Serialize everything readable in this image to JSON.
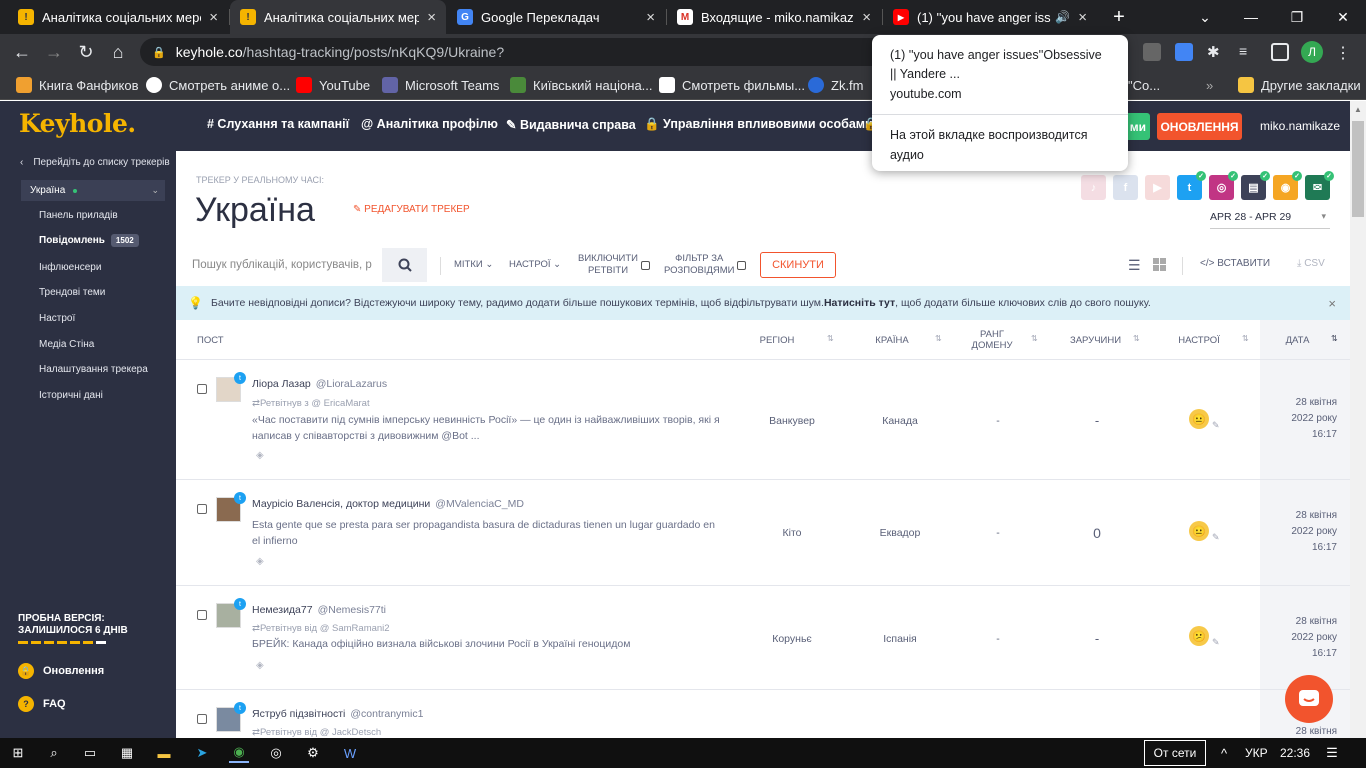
{
  "browser": {
    "tabs": [
      {
        "title": "Аналітика соціальних мереж",
        "active": false
      },
      {
        "title": "Аналітика соціальних мереж",
        "active": true
      },
      {
        "title": "Google Перекладач",
        "active": false
      },
      {
        "title": "Входящие - miko.namikaze.l",
        "active": false
      },
      {
        "title": "(1) ''you have anger iss",
        "active": false
      }
    ],
    "url_host": "keyhole.co",
    "url_path": "/hashtag-tracking/posts/nKqKQ9/Ukraine?",
    "bookmarks": [
      {
        "label": "Книга Фанфиков",
        "color": "#f0a030"
      },
      {
        "label": "Смотреть аниме о...",
        "color": "#ffffff"
      },
      {
        "label": "YouTube",
        "color": "#ff0000"
      },
      {
        "label": "Microsoft Teams",
        "color": "#6264a7"
      },
      {
        "label": "Київський націона...",
        "color": "#4a8a3a"
      },
      {
        "label": "Смотреть фильмы...",
        "color": "#ffffff"
      },
      {
        "label": "Zk.fm",
        "color": "#2a6ad8"
      },
      {
        "label": "\"Co...",
        "color": "#35363a"
      }
    ],
    "other_bookmarks": "Другие закладки",
    "profile_initial": "Л"
  },
  "tab_popup": {
    "title": "(1) ''you have anger issues''Obsessive || Yandere ...",
    "url": "youtube.com",
    "note": "На этой вкладке воспроизводится аудио"
  },
  "header": {
    "logo": "Keyhole.",
    "nav": [
      "# Слухання та кампанії",
      "@ Аналітика профілю",
      "✎ Видавнича справа",
      "🔒 Управління впливовими особами"
    ],
    "green_button": "ми",
    "upgrade_button": "ОНОВЛЕННЯ",
    "username": "miko.namikaze"
  },
  "sidebar": {
    "back": "Перейдіть до списку трекерів",
    "tracker_select": "Україна",
    "items": [
      {
        "label": "Панель приладів"
      },
      {
        "label": "Повідомлень",
        "badge": "1502",
        "active": true
      },
      {
        "label": "Інфлюенсери"
      },
      {
        "label": "Трендові теми"
      },
      {
        "label": "Настрої"
      },
      {
        "label": "Медіа Стіна"
      },
      {
        "label": "Налаштування трекера"
      },
      {
        "label": "Історичні дані"
      }
    ],
    "trial_line1": "ПРОБНА ВЕРСІЯ:",
    "trial_line2": "ЗАЛИШИЛОСЯ 6 ДНІВ",
    "trial_days_left_fraction": 0.86,
    "upgrade_link": "Оновлення",
    "faq_link": "FAQ"
  },
  "tracker": {
    "label": "ТРЕКЕР У РЕАЛЬНОМУ ЧАСІ:",
    "title": "Україна",
    "edit": "✎ РЕДАГУВАТИ ТРЕКЕР",
    "date_range": "APR 28 - APR 29",
    "networks": [
      {
        "name": "tiktok",
        "glyph": "♪",
        "color": "#e0a0b0",
        "on": false
      },
      {
        "name": "facebook",
        "glyph": "f",
        "color": "#9aaed0",
        "on": false
      },
      {
        "name": "youtube",
        "glyph": "▶",
        "color": "#e89a9a",
        "on": false
      },
      {
        "name": "twitter",
        "glyph": "t",
        "color": "#1da1f2",
        "on": true
      },
      {
        "name": "instagram",
        "glyph": "◎",
        "color": "#c13584",
        "on": true
      },
      {
        "name": "news",
        "glyph": "▤",
        "color": "#3d4258",
        "on": true
      },
      {
        "name": "rss",
        "glyph": "◉",
        "color": "#f5a623",
        "on": true
      },
      {
        "name": "forums",
        "glyph": "✉",
        "color": "#1f7a55",
        "on": true
      }
    ]
  },
  "filters": {
    "search_placeholder": "Пошук публікацій, користувачів, р",
    "tags": "МІТКИ",
    "moods": "НАСТРОЇ",
    "exclude_retweets_1": "ВИКЛЮЧИТИ",
    "exclude_retweets_2": "РЕТВІТИ",
    "filter_replies_1": "ФІЛЬТР ЗА",
    "filter_replies_2": "РОЗПОВІДЯМИ",
    "reset": "СКИНУТИ",
    "insert": "ВСТАВИТИ",
    "csv": "CSV"
  },
  "notice": {
    "text": "Бачите невідповідні дописи? Відстежуючи широку тему, радимо додати більше пошукових термінів, щоб відфільтрувати шум. ",
    "link": "Натисніть тут",
    "text_after": " , щоб додати більше ключових слів до свого пошуку."
  },
  "table": {
    "columns": {
      "post": "ПОСТ",
      "region": "РЕГІОН",
      "country": "КРАЇНА",
      "domain_rank_1": "РАНГ",
      "domain_rank_2": "ДОМЕНУ",
      "engagement": "ЗАРУЧИНИ",
      "sentiment": "НАСТРОЇ",
      "date": "ДАТА"
    },
    "rows": [
      {
        "author": "Ліора Лазар",
        "handle": "@LioraLazarus",
        "retweet": "Ретвітнув з @ EricaMarat",
        "text": "«Час поставити під сумнів імперську невинність Росії» — це один із найважливіших творів, які я написав у співавторстві з дивовижним @Bot ...",
        "region": "Ванкувер",
        "country": "Канада",
        "rank": "-",
        "engagement": "-",
        "mood": "neutral",
        "date1": "28 квітня",
        "date2": "2022 року",
        "date3": "16:17"
      },
      {
        "author": "Маурісіо Валенсія, доктор медицини",
        "handle": "@MValenciaC_MD",
        "retweet": "",
        "text": "Esta gente que se presta para ser propagandista basura de dictaduras tienen un lugar guardado en el infierno",
        "region": "Кіто",
        "country": "Еквадор",
        "rank": "-",
        "engagement": "0",
        "mood": "neutral",
        "date1": "28 квітня",
        "date2": "2022 року",
        "date3": "16:17"
      },
      {
        "author": "Немезида77",
        "handle": "@Nemesis77ti",
        "retweet": "Ретвітнув від @ SamRamani2",
        "text": "БРЕЙК: Канада офіційно визнала військові злочини Росії в Україні геноцидом",
        "region": "Коруньє",
        "country": "Іспанія",
        "rank": "-",
        "engagement": "-",
        "mood": "confused",
        "date1": "28 квітня",
        "date2": "2022 року",
        "date3": "16:17"
      },
      {
        "author": "Яструб підзвітності",
        "handle": "@contranymic1",
        "retweet": "Ретвітнув від @ JackDetsch",
        "text": "",
        "region": "",
        "country": "",
        "rank": "",
        "engagement": "",
        "mood": "",
        "date1": "28 квітня",
        "date2": "",
        "date3": ""
      }
    ]
  },
  "taskbar": {
    "network": "От сети",
    "lang": "УКР",
    "time": "22:36"
  }
}
